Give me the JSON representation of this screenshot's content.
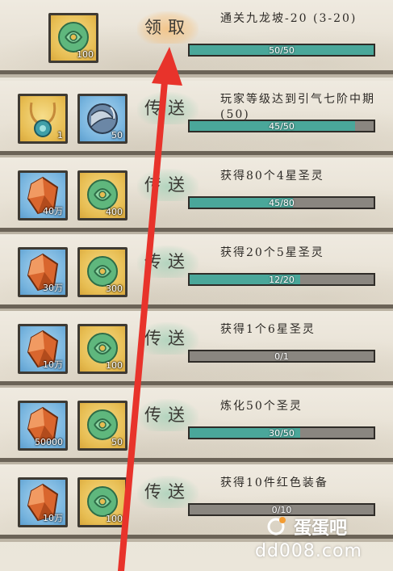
{
  "rows": [
    {
      "action": "领取",
      "task": "通关九龙坡-20 (3-20)",
      "progress_text": "50/50",
      "progress": 1.0,
      "items": [
        {
          "icon": "jade-pendant-icon",
          "qty": "100"
        }
      ]
    },
    {
      "action": "传送",
      "task": "玩家等级达到引气七阶中期 (50)",
      "progress_text": "45/50",
      "progress": 0.9,
      "items": [
        {
          "icon": "amulet-necklace-icon",
          "qty": "1"
        },
        {
          "icon": "spirit-orb-icon",
          "qty": "50"
        }
      ]
    },
    {
      "action": "传送",
      "task": "获得80个4星圣灵",
      "progress_text": "45/80",
      "progress": 0.5625,
      "items": [
        {
          "icon": "orange-crystal-icon",
          "qty": "40万"
        },
        {
          "icon": "jade-pendant-icon",
          "qty": "400"
        }
      ]
    },
    {
      "action": "传送",
      "task": "获得20个5星圣灵",
      "progress_text": "12/20",
      "progress": 0.6,
      "items": [
        {
          "icon": "orange-crystal-icon",
          "qty": "30万"
        },
        {
          "icon": "jade-pendant-icon",
          "qty": "300"
        }
      ]
    },
    {
      "action": "传送",
      "task": "获得1个6星圣灵",
      "progress_text": "0/1",
      "progress": 0.0,
      "items": [
        {
          "icon": "orange-crystal-icon",
          "qty": "10万"
        },
        {
          "icon": "jade-pendant-icon",
          "qty": "100"
        }
      ]
    },
    {
      "action": "传送",
      "task": "炼化50个圣灵",
      "progress_text": "30/50",
      "progress": 0.6,
      "items": [
        {
          "icon": "orange-crystal-icon",
          "qty": "50000"
        },
        {
          "icon": "jade-pendant-icon",
          "qty": "50"
        }
      ]
    },
    {
      "action": "传送",
      "task": "获得10件红色装备",
      "progress_text": "0/10",
      "progress": 0.0,
      "items": [
        {
          "icon": "orange-crystal-icon",
          "qty": "10万"
        },
        {
          "icon": "jade-pendant-icon",
          "qty": "100"
        }
      ]
    }
  ],
  "watermark": {
    "logo": "蛋蛋吧",
    "url": "dd008.com"
  },
  "colors": {
    "progress_fill": "#4aa79a",
    "progress_track": "#8a8680",
    "arrow": "#e8332b",
    "claim_glow": "#f5be78",
    "teleport_glow": "#87c8aa"
  }
}
